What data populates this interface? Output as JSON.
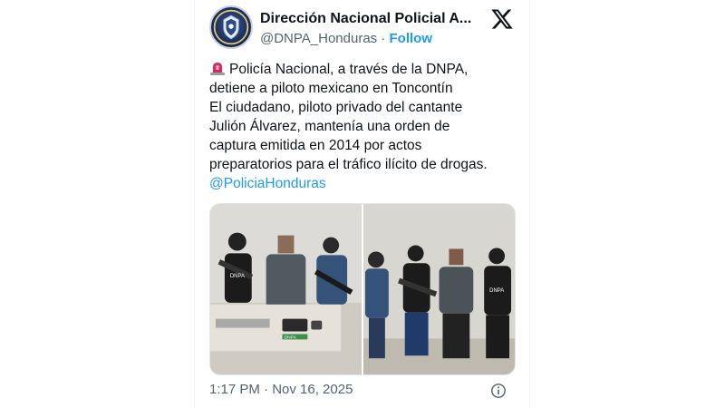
{
  "tweet": {
    "author_name": "Dirección Nacional Policial A...",
    "handle": "@DNPA_Honduras",
    "separator": "·",
    "follow_label": "Follow",
    "text_lines": [
      "Policía Nacional, a través de la DNPA,",
      "detiene a piloto mexicano en Toncontín",
      "El ciudadano, piloto privado del cantante",
      "Julión Álvarez, mantenía una orden de",
      "captura emitida en 2014 por actos",
      "preparatorios para el tráfico ilícito de drogas."
    ],
    "mention": "@PoliciaHonduras",
    "timestamp": "1:17 PM · Nov 16, 2025",
    "media_labels": {
      "vest_left": "DNPA",
      "box": "DNPA",
      "vest_right": "DNPA"
    }
  },
  "icons": {
    "avatar": "police-badge-icon",
    "logo": "x-logo-icon",
    "siren": "rotating-light-icon",
    "info": "info-icon"
  },
  "colors": {
    "link": "#1d9bf0",
    "secondary_text": "#536471",
    "text": "#0f1419"
  }
}
